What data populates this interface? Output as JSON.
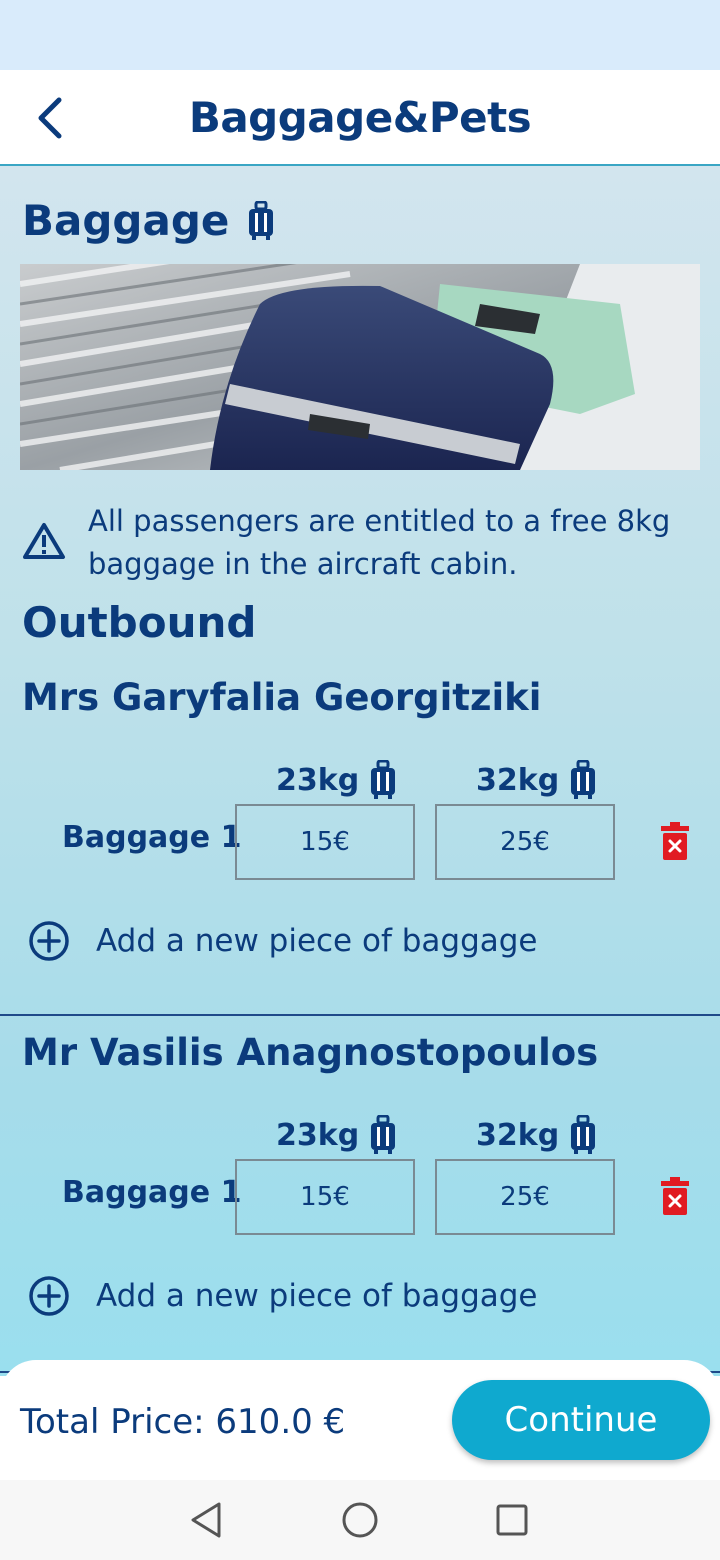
{
  "header": {
    "title": "Baggage&Pets"
  },
  "section": {
    "title": "Baggage"
  },
  "notice": {
    "text": "All passengers are entitled to a free 8kg baggage in the aircraft cabin."
  },
  "leg": {
    "title": "Outbound"
  },
  "passengers": [
    {
      "name": "Mrs Garyfalia Georgitziki",
      "weight_options": [
        "23kg",
        "32kg"
      ],
      "bag_label": "Baggage 1",
      "prices": [
        "15€",
        "25€"
      ],
      "add_label": "Add a new piece of baggage"
    },
    {
      "name": "Mr Vasilis Anagnostopoulos",
      "weight_options": [
        "23kg",
        "32kg"
      ],
      "bag_label": "Baggage 1",
      "prices": [
        "15€",
        "25€"
      ],
      "add_label": "Add a new piece of baggage"
    }
  ],
  "footer": {
    "total": "Total Price: 610.0 €",
    "continue_label": "Continue"
  },
  "colors": {
    "brand_navy": "#0b3b7c",
    "accent": "#0fa9cf",
    "delete": "#e11b22"
  },
  "icons": [
    "back-icon",
    "luggage-icon",
    "warning-icon",
    "trash-icon",
    "plus-circle-icon",
    "nav-back-icon",
    "nav-home-icon",
    "nav-recents-icon"
  ]
}
